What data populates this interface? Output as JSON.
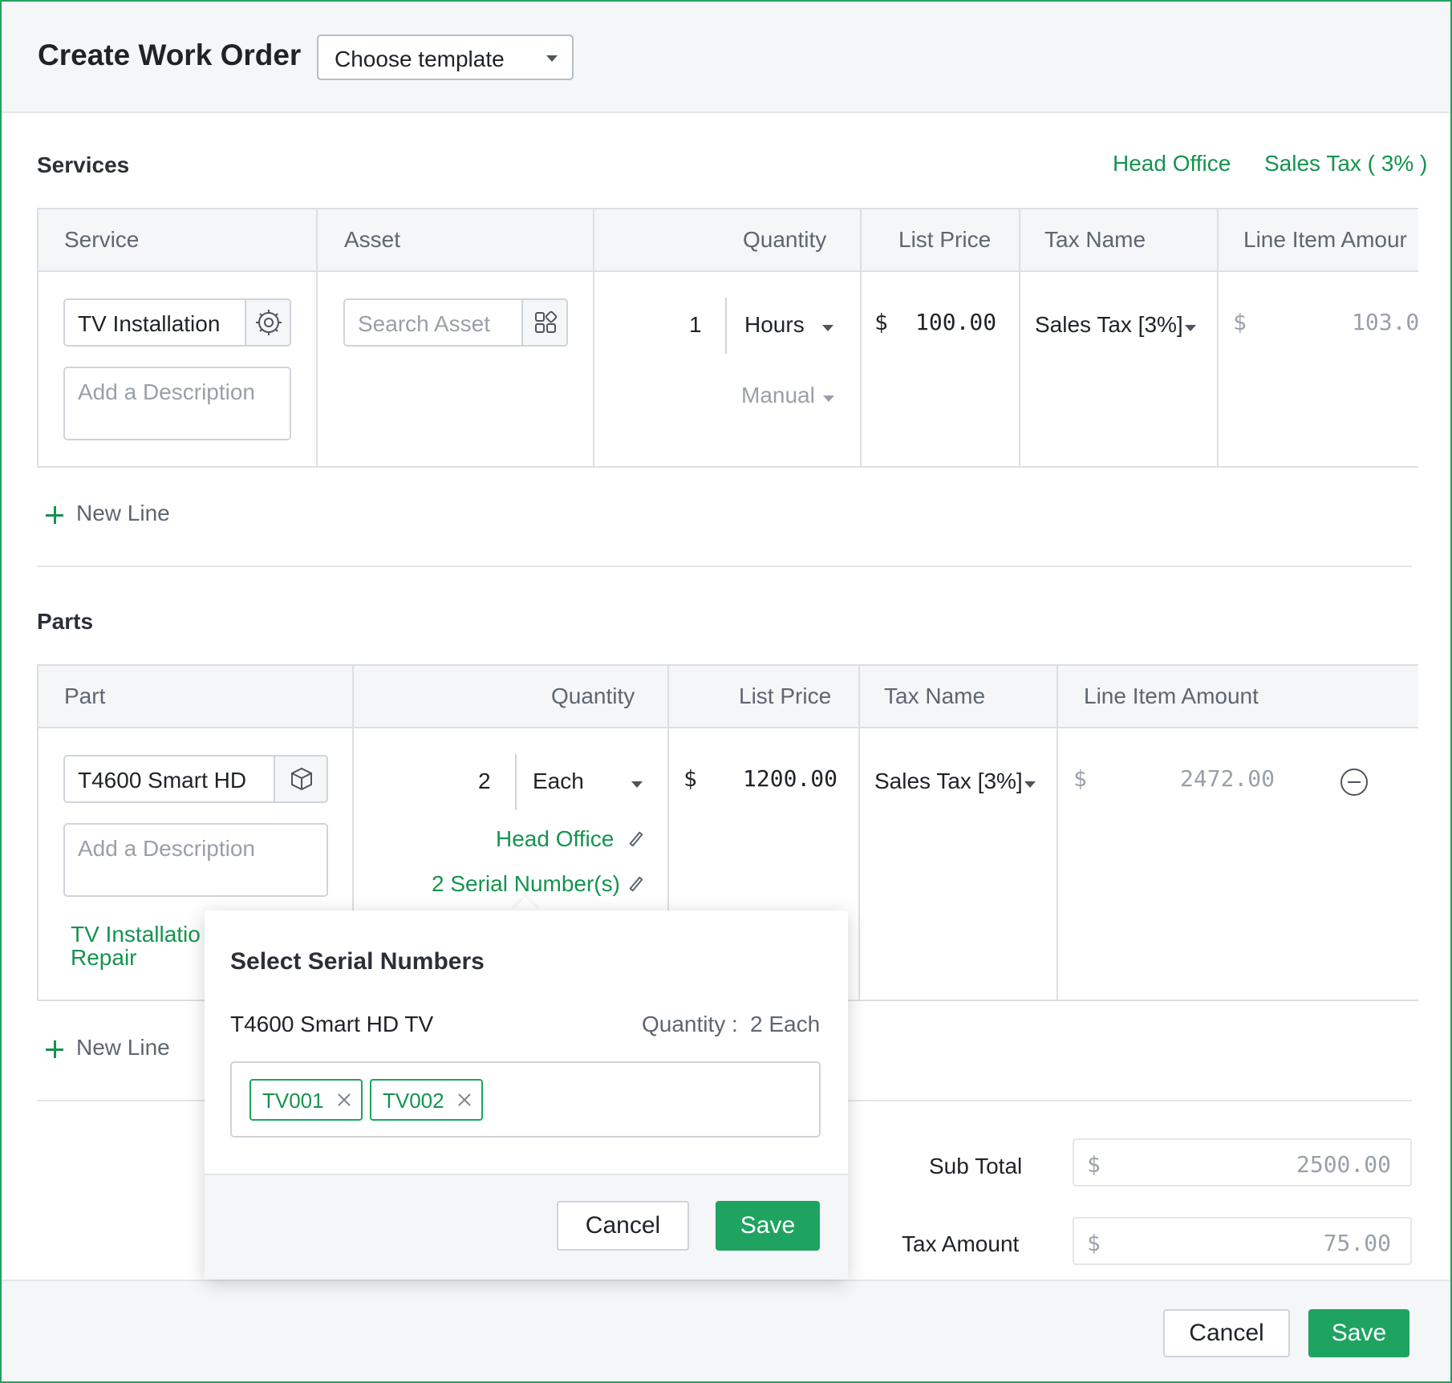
{
  "dialog": {
    "title": "Create Work Order",
    "template_select": "Choose template"
  },
  "services": {
    "title": "Services",
    "head_office_link": "Head Office",
    "sales_tax_link": "Sales Tax ( 3% )",
    "columns": [
      "Service",
      "Asset",
      "Quantity",
      "List Price",
      "Tax Name",
      "Line Item Amour"
    ],
    "row": {
      "service": "TV Installation",
      "description_placeholder": "Add a Description",
      "asset_placeholder": "Search Asset",
      "quantity": "1",
      "unit": "Hours",
      "pricing_mode": "Manual",
      "currency": "$",
      "list_price": "100.00",
      "tax_name": "Sales Tax [3%]",
      "line_amount": "103.0"
    },
    "new_line": "New Line"
  },
  "parts": {
    "title": "Parts",
    "columns": [
      "Part",
      "Quantity",
      "List Price",
      "Tax Name",
      "Line Item Amount"
    ],
    "row": {
      "part": "T4600 Smart HD",
      "description_placeholder": "Add a Description",
      "related_service_line1": "TV Installatio",
      "related_service_line2": "Repair",
      "quantity": "2",
      "unit": "Each",
      "warehouse": "Head Office",
      "serials": "2 Serial Number(s)",
      "currency": "$",
      "list_price": "1200.00",
      "tax_name": "Sales Tax [3%]",
      "line_amount": "2472.00"
    },
    "new_line": "New Line"
  },
  "totals": {
    "sub_total_label": "Sub Total",
    "sub_total_currency": "$",
    "sub_total_value": "2500.00",
    "tax_amount_label": "Tax Amount",
    "tax_amount_currency": "$",
    "tax_amount_value": "75.00"
  },
  "footer": {
    "cancel": "Cancel",
    "save": "Save"
  },
  "popup": {
    "title": "Select Serial Numbers",
    "item_name": "T4600 Smart HD TV",
    "quantity_label": "Quantity :",
    "quantity_value": "2 Each",
    "serials": [
      "TV001",
      "TV002"
    ],
    "cancel": "Cancel",
    "save": "Save"
  },
  "colors": {
    "accent": "#1fa361",
    "link": "#15934f"
  }
}
